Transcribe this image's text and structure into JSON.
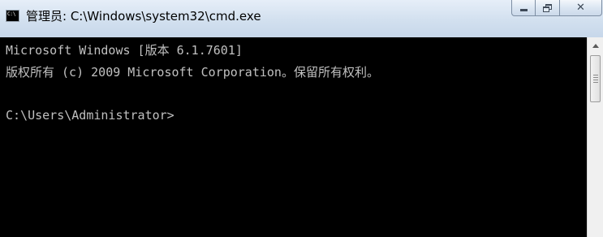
{
  "window": {
    "title": "管理员: C:\\Windows\\system32\\cmd.exe",
    "icon": "cmd-app-icon",
    "icon_text": "C:\\"
  },
  "controls": {
    "minimize_icon": "minimize-icon",
    "maximize_icon": "restore-icon",
    "close_icon": "close-icon",
    "close_glyph": "✕"
  },
  "console": {
    "lines": [
      "Microsoft Windows [版本 6.1.7601]",
      "版权所有 (c) 2009 Microsoft Corporation。保留所有权利。",
      "C:\\Users\\Administrator>"
    ],
    "background": "#000000",
    "text_color": "#c0c0c0"
  },
  "scrollbar": {
    "up_icon": "scroll-up-arrow-icon",
    "position_fraction": 0
  }
}
